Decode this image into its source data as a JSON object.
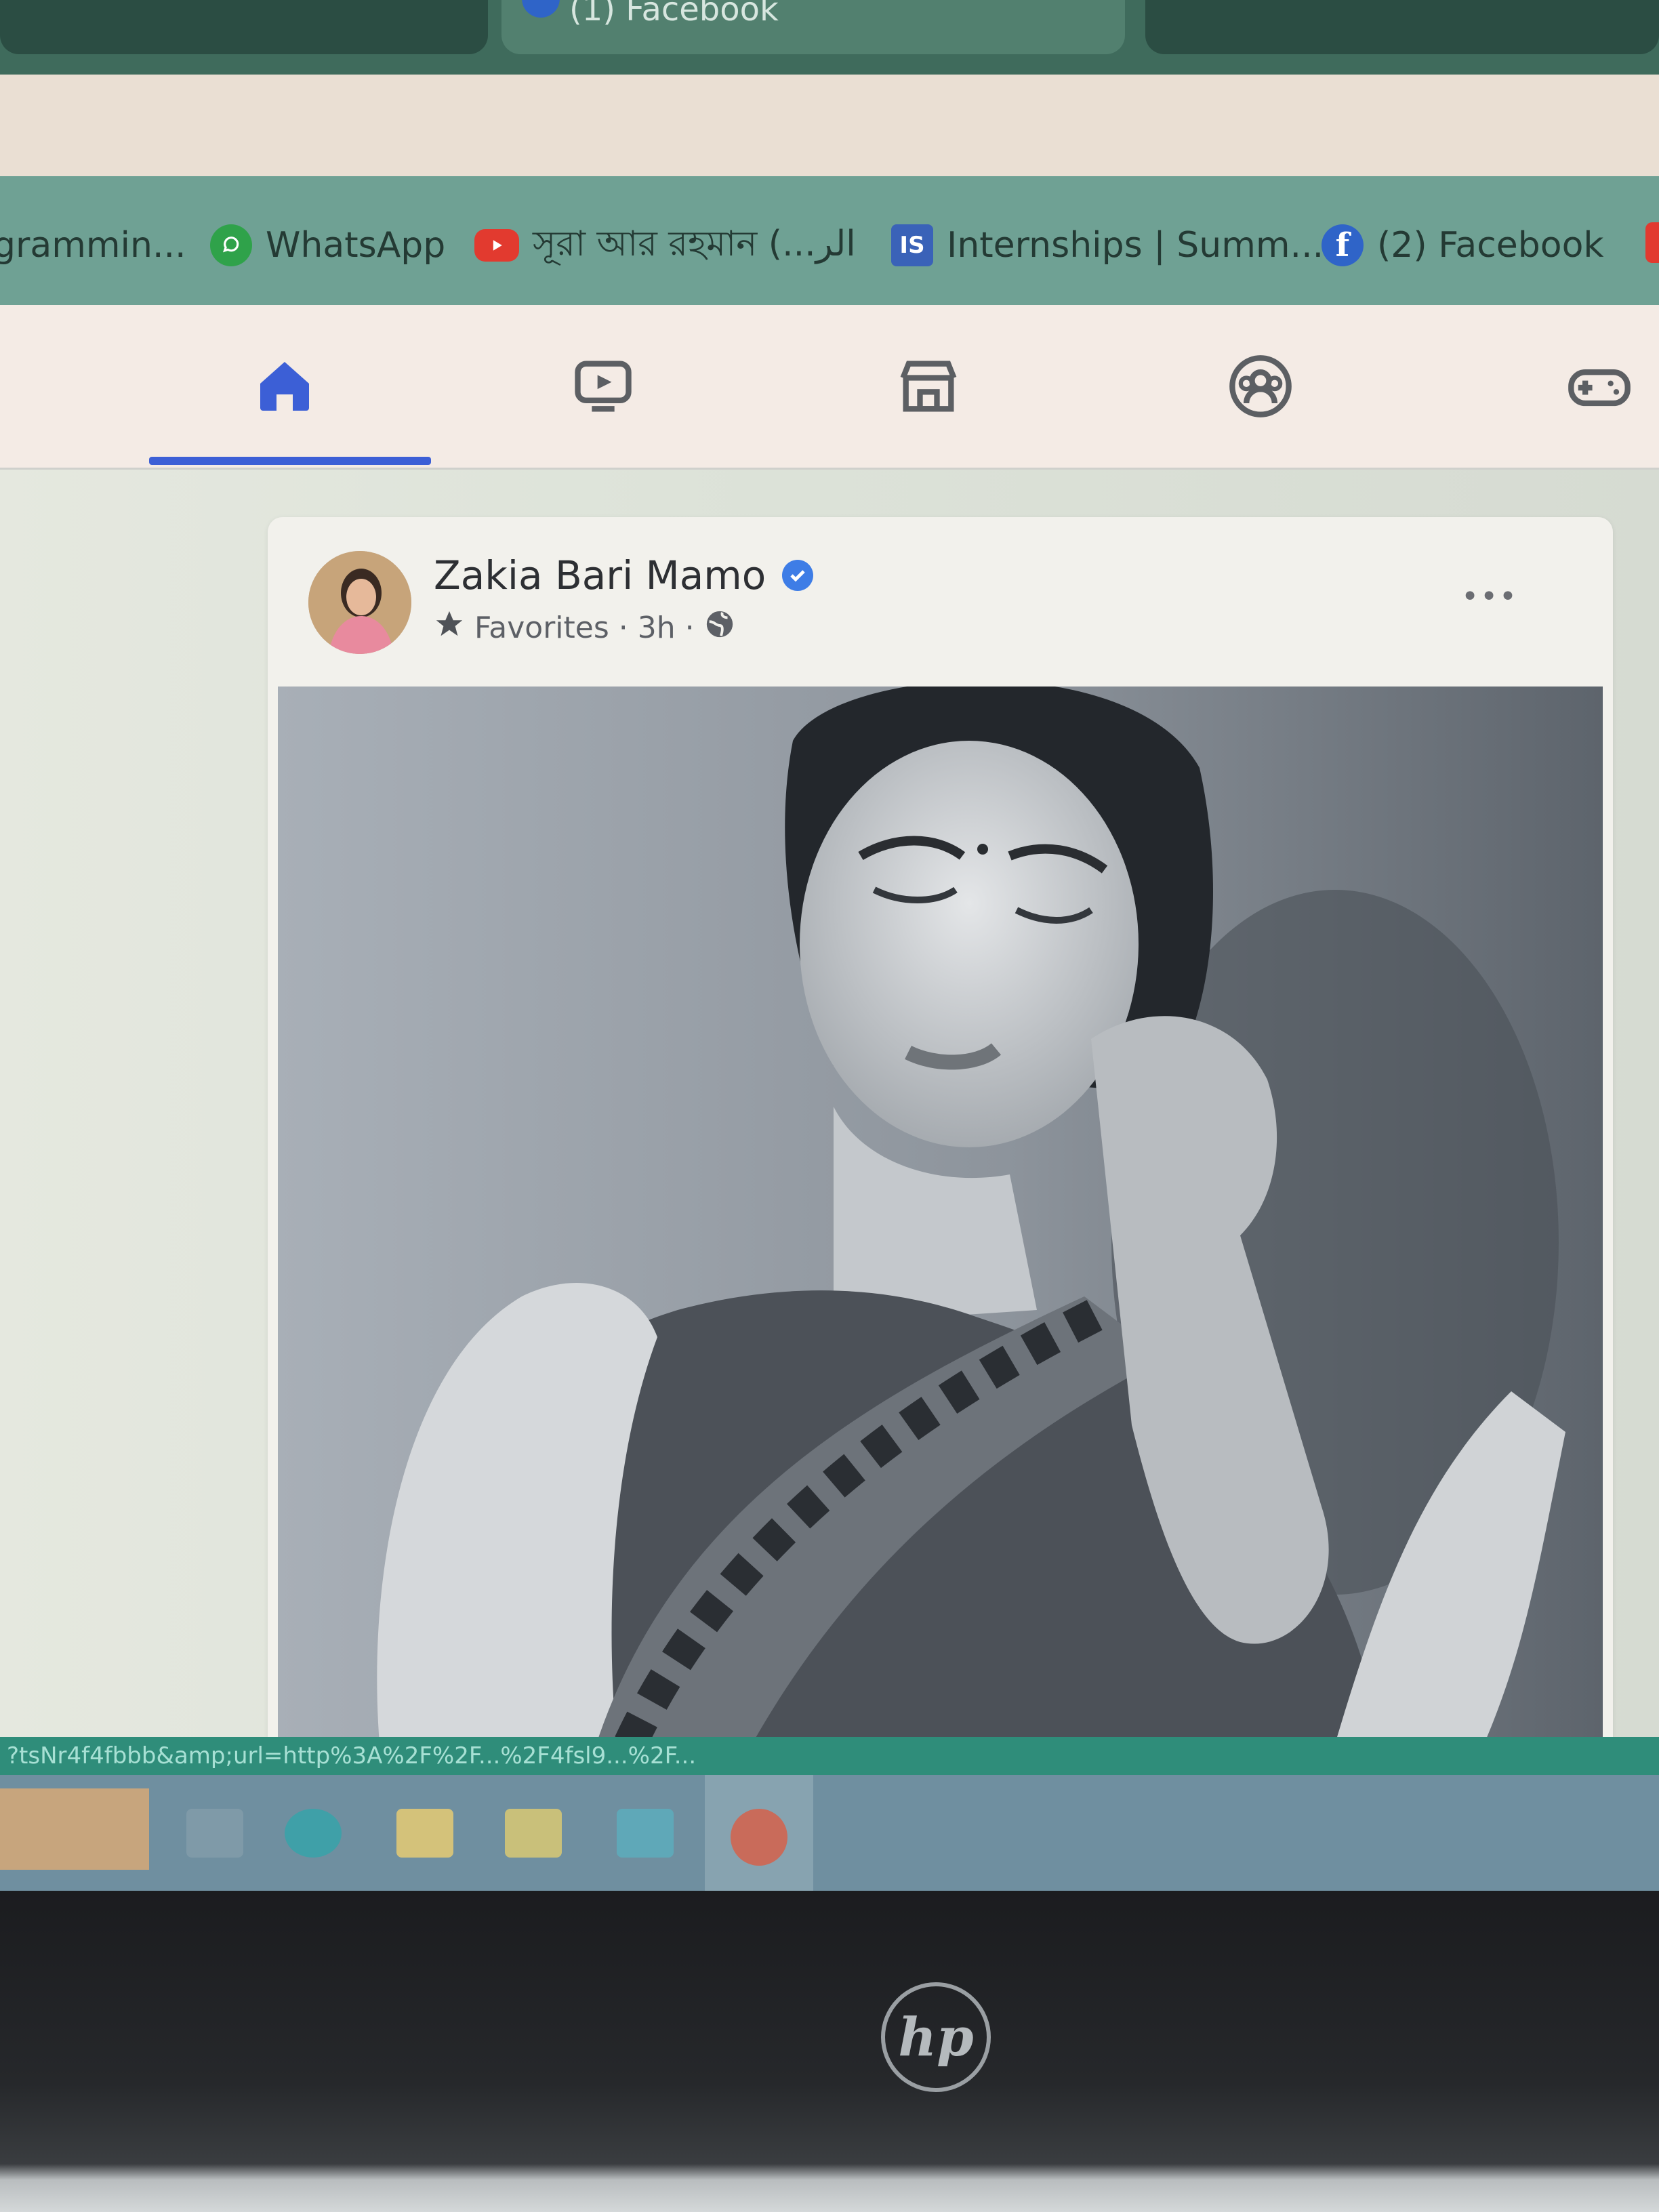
{
  "browser": {
    "tabs": [
      {
        "label": "(1) Facebook",
        "active": true
      }
    ],
    "bookmarks": [
      {
        "label": "grammin...",
        "icon": "bookmark-icon"
      },
      {
        "label": "WhatsApp",
        "icon": "whatsapp-icon"
      },
      {
        "label": "সূরা আর রহমান (...الر",
        "icon": "youtube-icon"
      },
      {
        "label": "Internships | Summ...",
        "icon": "internshala-icon",
        "icon_text": "IS"
      },
      {
        "label": "(2) Facebook",
        "icon": "facebook-icon",
        "icon_text": "f"
      }
    ]
  },
  "facebook_nav": {
    "items": [
      "home-icon",
      "watch-icon",
      "marketplace-icon",
      "groups-icon",
      "gaming-icon"
    ],
    "active": "home-icon",
    "accent": "#3c5fd6"
  },
  "post": {
    "author": "Zakia Bari Mamo",
    "verified": true,
    "audience_label": "Favorites",
    "time": "3h",
    "separator": "·",
    "more_label": "•••"
  },
  "status_url": "?tsNr4f4fbbb&amp;url=http%3A%2F%2F...%2F4fsl9...%2F...",
  "device": {
    "brand": "hp"
  }
}
